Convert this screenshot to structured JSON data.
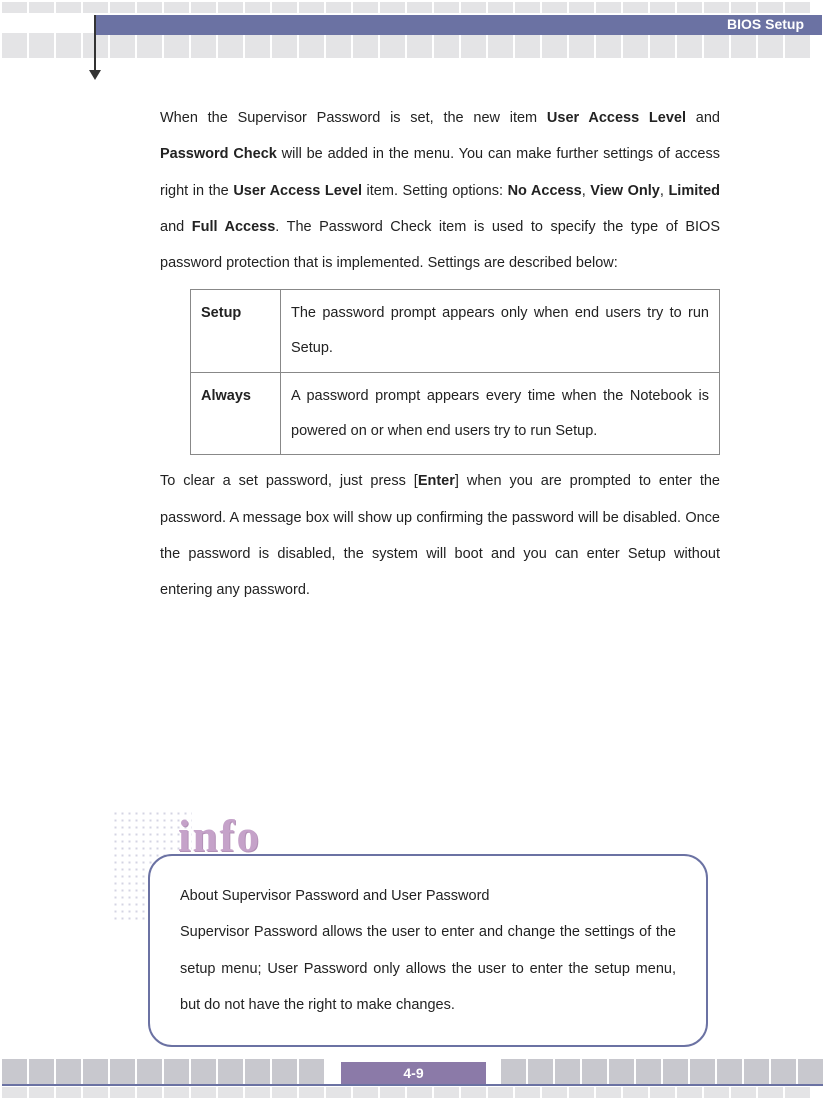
{
  "header": {
    "title": "BIOS Setup"
  },
  "body": {
    "para1_a": "When the Supervisor Password is set, the new item ",
    "para1_b1": "User Access Level",
    "para1_c": " and ",
    "para1_b2": "Password Check",
    "para1_d": " will be added in the menu.   You can make further settings of access right in the ",
    "para1_b3": "User Access Level",
    "para1_e": " item.   Setting options: ",
    "para1_b4": "No Access",
    "para1_f": ", ",
    "para1_b5": "View Only",
    "para1_g": ", ",
    "para1_b6": "Limited",
    "para1_h": " and ",
    "para1_b7": "Full Access",
    "para1_i": ".   The Password Check item is used to specify the type of BIOS password protection that is implemented.   Settings are described below:",
    "table": {
      "row1": {
        "label": "Setup",
        "desc": "The password prompt appears only when end users try to run Setup."
      },
      "row2": {
        "label": "Always",
        "desc": "A password prompt appears every time when the Notebook is powered on or when end users try to run Setup."
      }
    },
    "para2_a": "To clear a set password, just press [",
    "para2_b1": "Enter",
    "para2_c": "] when you are prompted to enter the password.   A message box will show up confirming the password will be disabled.   Once the password is disabled, the system will boot and you can enter Setup without entering any password."
  },
  "info": {
    "heading": "info",
    "title": "About Supervisor Password and User Password",
    "text": "Supervisor Password allows the user to enter and change the settings of the setup menu; User Password only allows the user to enter the setup menu, but do not have the right to make changes."
  },
  "footer": {
    "page": "4-9"
  }
}
